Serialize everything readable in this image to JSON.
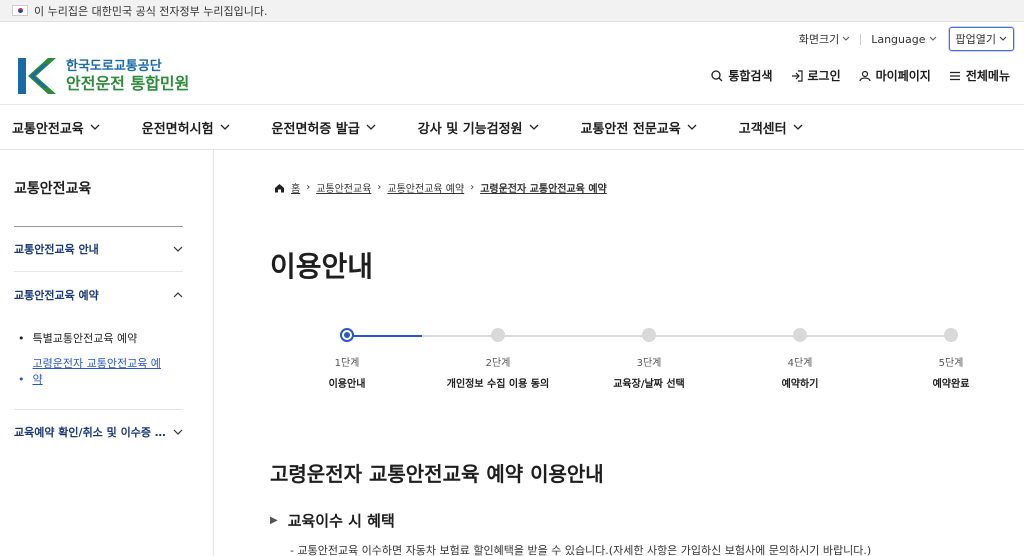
{
  "gov_banner": {
    "text": "이 누리집은 대한민국 공식 전자정부 누리집입니다."
  },
  "logo": {
    "top": "한국도로교통공단",
    "bottom": "안전운전 통합민원"
  },
  "util": {
    "font_size": "화면크기",
    "language": "Language",
    "popup": "팝업열기"
  },
  "main_util": {
    "search": "통합검색",
    "login": "로그인",
    "mypage": "마이페이지",
    "menu": "전체메뉴"
  },
  "gnb": [
    "교통안전교육",
    "운전면허시험",
    "운전면허증 발급",
    "강사 및 기능검정원",
    "교통안전 전문교육",
    "고객센터"
  ],
  "side": {
    "title": "교통안전교육",
    "items": [
      {
        "label": "교통안전교육 안내"
      },
      {
        "label": "교통안전교육 예약"
      },
      {
        "label": "교육예약 확인/취소 및 이수증 …"
      }
    ],
    "sub": [
      {
        "label": "특별교통안전교육 예약"
      },
      {
        "label": "고령운전자 교통안전교육 예약"
      }
    ]
  },
  "breadcrumb": {
    "home": "홈",
    "l1": "교통안전교육",
    "l2": "교통안전교육 예약",
    "current": "고령운전자 교통안전교육 예약"
  },
  "page_title": "이용안내",
  "steps": [
    {
      "num": "1단계",
      "label": "이용안내"
    },
    {
      "num": "2단계",
      "label": "개인정보 수집 이용 동의"
    },
    {
      "num": "3단계",
      "label": "교육장/날짜 선택"
    },
    {
      "num": "4단계",
      "label": "예약하기"
    },
    {
      "num": "5단계",
      "label": "예약완료"
    }
  ],
  "section": {
    "title": "고령운전자 교통안전교육 예약 이용안내",
    "subtitle": "교육이수 시 혜택",
    "desc": "- 교통안전교육 이수하면 자동차 보험료 할인혜택을 받을 수 있습니다.(자세한 사항은 가입하신 보험사에 문의하시기 바랍니다.)"
  },
  "colors": {
    "primary": "#2a57c6",
    "logo_blue": "#1a6aa8",
    "logo_green": "#2e8b3c"
  }
}
